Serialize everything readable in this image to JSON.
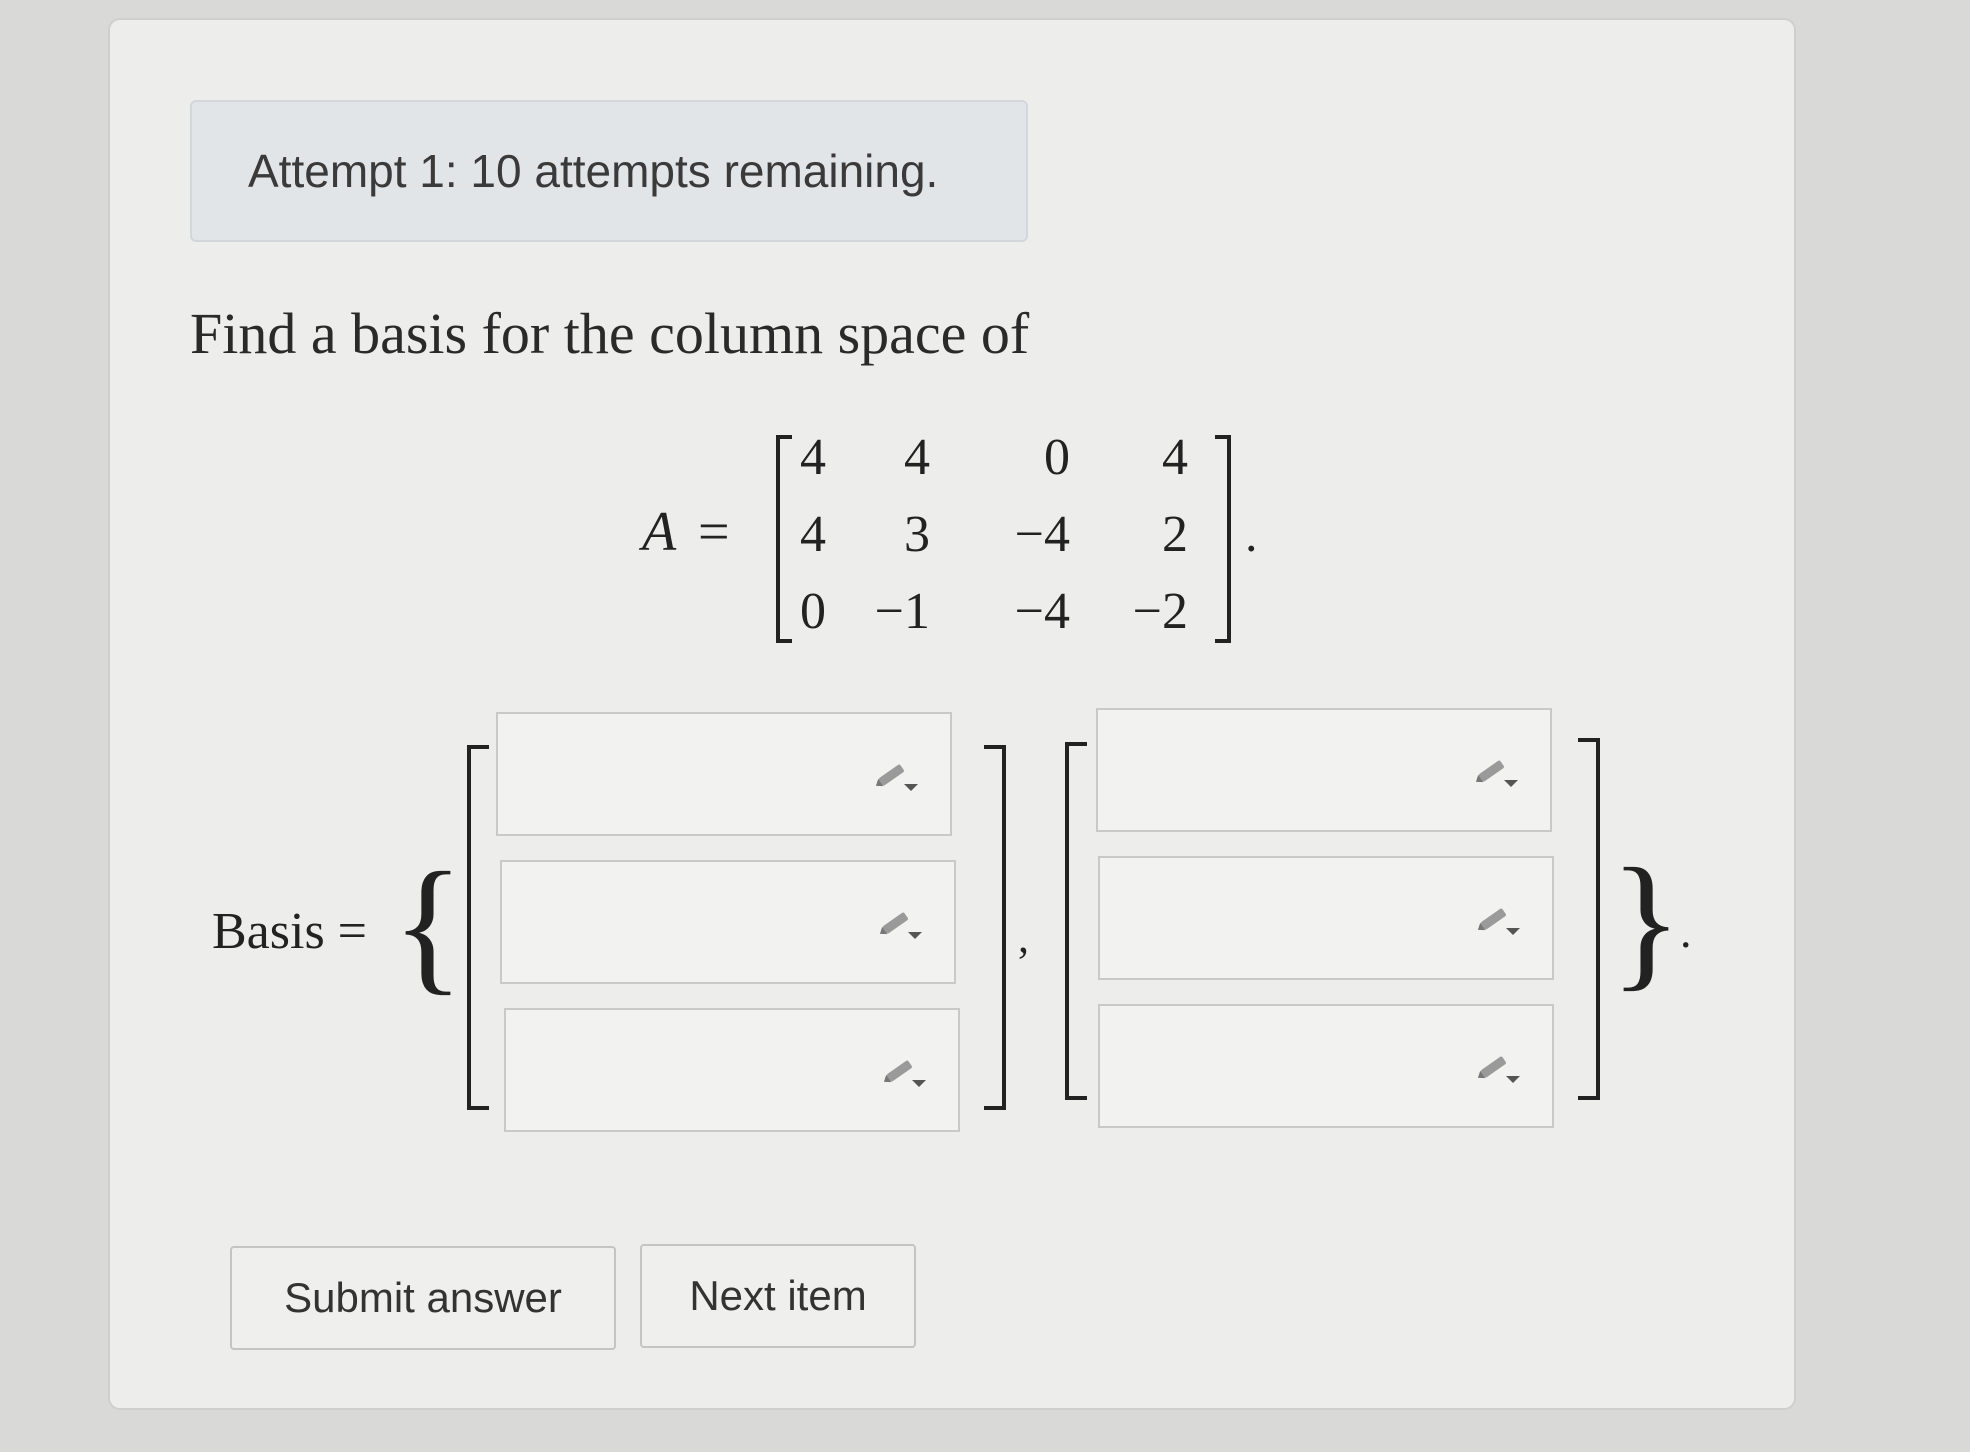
{
  "attempt_banner": "Attempt 1: 10 attempts remaining.",
  "question": {
    "prompt": "Find a basis for the column space of",
    "matrix_name": "A",
    "equals": "=",
    "matrix": [
      [
        "4",
        "4",
        "0",
        "4"
      ],
      [
        "4",
        "3",
        "−4",
        "2"
      ],
      [
        "0",
        "−1",
        "−4",
        "−2"
      ]
    ],
    "matrix_end": "."
  },
  "answer": {
    "label": "Basis =",
    "open_brace": "{",
    "close_brace": "}",
    "separator": ",",
    "end": ".",
    "vector1": [
      "",
      "",
      ""
    ],
    "vector2": [
      "",
      "",
      ""
    ],
    "field_icon": "pencil-dropdown-icon"
  },
  "buttons": {
    "submit": "Submit answer",
    "next": "Next item"
  }
}
